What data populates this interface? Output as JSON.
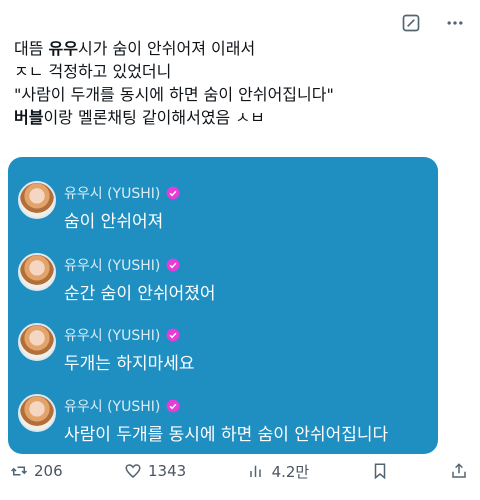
{
  "post": {
    "lines": [
      {
        "prefix": "대뜸 ",
        "bold": "유우",
        "suffix": "시가 숨이 안쉬어져 이래서"
      },
      {
        "prefix": "ㅈㄴ 걱정하고 있었더니",
        "bold": "",
        "suffix": ""
      },
      {
        "prefix": "\"사람이 두개를 동시에 하면 숨이 안쉬어집니다\"",
        "bold": "",
        "suffix": ""
      },
      {
        "prefix": "",
        "bold": "버블",
        "suffix": "이랑 멜론채팅 같이해서였음 ㅅㅂ"
      }
    ]
  },
  "embed": {
    "background": "#1f8fc1",
    "accent": "#e83bd8",
    "messages": [
      {
        "name": "유우시 (YUSHI)",
        "text": "숨이 안쉬어져"
      },
      {
        "name": "유우시 (YUSHI)",
        "text": "순간 숨이 안쉬어졌어"
      },
      {
        "name": "유우시 (YUSHI)",
        "text": "두개는 하지마세요"
      },
      {
        "name": "유우시 (YUSHI)",
        "text": "사람이 두개를 동시에 하면 숨이 안쉬어집니다"
      }
    ]
  },
  "actions": {
    "retweets": "206",
    "likes": "1343",
    "views": "4.2만",
    "icons": [
      "retweet-icon",
      "heart-icon",
      "views-icon",
      "bookmark-icon",
      "share-icon"
    ]
  },
  "top_icons": [
    "grok-icon",
    "more-icon"
  ]
}
